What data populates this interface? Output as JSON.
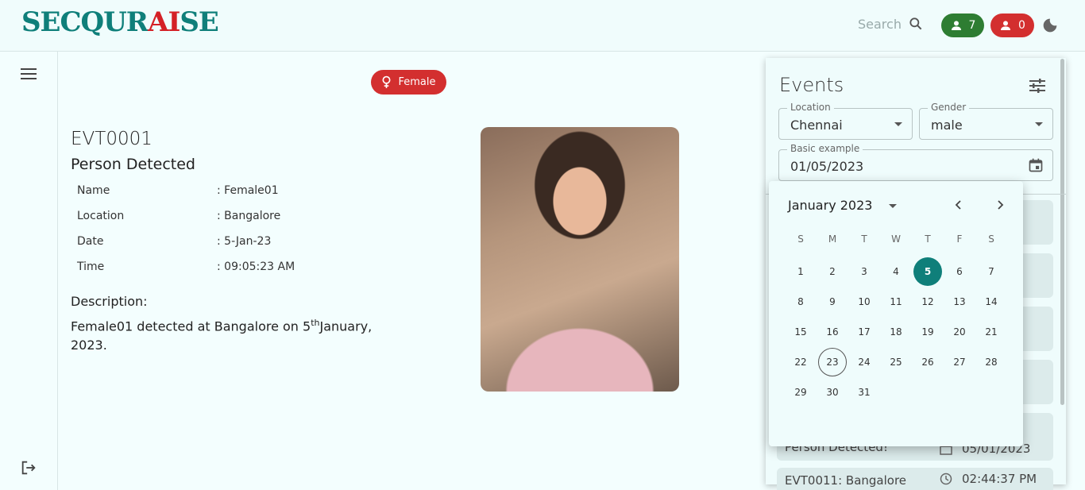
{
  "header": {
    "logo_secqur": "SECQUR",
    "logo_ai": "AI",
    "logo_se": "SE",
    "search_label": "Search",
    "male_count": "7",
    "female_count": "0"
  },
  "event": {
    "gender_chip": "Female",
    "id": "EVT0001",
    "title": "Person Detected",
    "fields": [
      {
        "label": "Name",
        "value": ": Female01"
      },
      {
        "label": "Location",
        "value": ": Bangalore"
      },
      {
        "label": "Date",
        "value": ": 5-Jan-23"
      },
      {
        "label": "Time",
        "value": ": 09:05:23 AM"
      }
    ],
    "description_label": "Description:",
    "description_pre": "Female01 detected at Bangalore on 5",
    "description_sup": "th",
    "description_post": "January, 2023."
  },
  "events_panel": {
    "title": "Events",
    "location_label": "Location",
    "location_value": "Chennai",
    "gender_label": "Gender",
    "gender_value": "male",
    "date_label": "Basic example",
    "date_value": "01/05/2023",
    "cards": [
      {
        "text": "Person Detected!",
        "date": "05/01/2023"
      },
      {
        "text": "EVT0011: Bangalore",
        "time": "02:44:37 PM"
      }
    ]
  },
  "calendar": {
    "month_label": "January 2023",
    "weekdays": [
      "S",
      "M",
      "T",
      "W",
      "T",
      "F",
      "S"
    ],
    "days": [
      "1",
      "2",
      "3",
      "4",
      "5",
      "6",
      "7",
      "8",
      "9",
      "10",
      "11",
      "12",
      "13",
      "14",
      "15",
      "16",
      "17",
      "18",
      "19",
      "20",
      "21",
      "22",
      "23",
      "24",
      "25",
      "26",
      "27",
      "28",
      "29",
      "30",
      "31"
    ],
    "selected_day": "5",
    "today_day": "23"
  },
  "colors": {
    "brand": "#0f7f7a",
    "accent_red": "#d32f2f",
    "accent_green": "#2e7d32"
  }
}
